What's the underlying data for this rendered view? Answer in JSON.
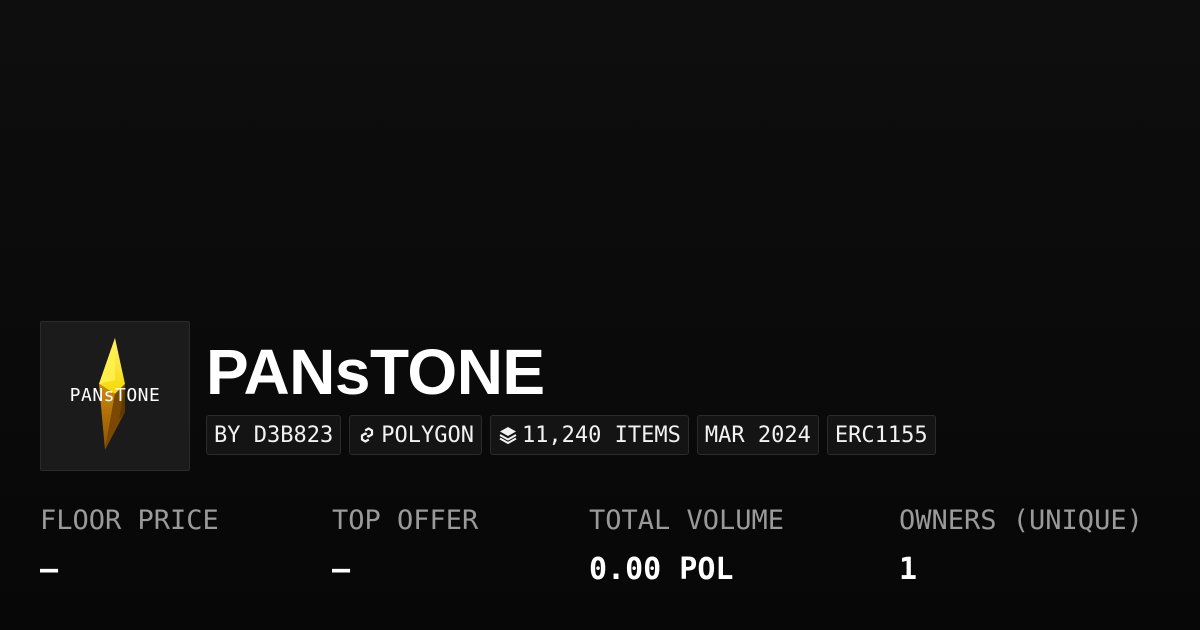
{
  "collection": {
    "title": "PANsTONE",
    "logo_text": "PANsTONE",
    "logo_icon": "gem-crystal-icon",
    "accent_color": "#f5d800"
  },
  "chips": [
    {
      "label": "BY D3B823",
      "icon": null
    },
    {
      "label": "POLYGON",
      "icon": "chain-link-icon"
    },
    {
      "label": "11,240 ITEMS",
      "icon": "layers-icon"
    },
    {
      "label": "MAR 2024",
      "icon": null
    },
    {
      "label": "ERC1155",
      "icon": null
    }
  ],
  "stats": [
    {
      "label": "FLOOR PRICE",
      "value": "–"
    },
    {
      "label": "TOP OFFER",
      "value": "–"
    },
    {
      "label": "TOTAL VOLUME",
      "value": "0.00 POL"
    },
    {
      "label": "OWNERS (UNIQUE)",
      "value": "1"
    }
  ]
}
